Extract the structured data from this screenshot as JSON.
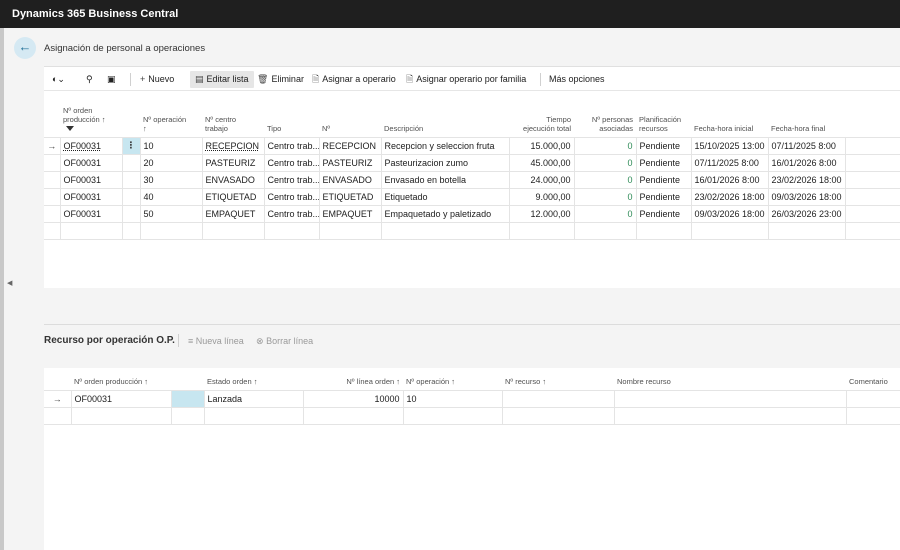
{
  "app": {
    "title": "Dynamics 365 Business Central"
  },
  "page": {
    "title": "Asignación de personal a operaciones"
  },
  "toolbar": {
    "nuevo": "Nuevo",
    "editar_lista": "Editar lista",
    "eliminar": "Eliminar",
    "asignar_operario": "Asignar a operario",
    "asignar_familia": "Asignar operario por familia",
    "mas_opciones": "Más opciones"
  },
  "main_grid": {
    "headers": {
      "orden_l1": "Nº orden",
      "orden_l2": "producción ↑",
      "operacion_l1": "Nº operación",
      "operacion_l2": "↑",
      "centro_l1": "Nº centro",
      "centro_l2": "trabajo",
      "tipo": "Tipo",
      "no": "Nº",
      "descripcion": "Descripción",
      "tiempo_l1": "Tiempo",
      "tiempo_l2": "ejecución total",
      "personas_l1": "Nº personas",
      "personas_l2": "asociadas",
      "planif_l1": "Planificación",
      "planif_l2": "recursos",
      "fecha_ini": "Fecha-hora inicial",
      "fecha_fin": "Fecha-hora final"
    },
    "rows": [
      {
        "orden": "OF00031",
        "operacion": "10",
        "centro": "RECEPCION",
        "tipo": "Centro trab...",
        "no": "RECEPCION",
        "descripcion": "Recepcion y seleccion fruta",
        "tiempo": "15.000,00",
        "personas": "0",
        "planif": "Pendiente",
        "fecha_ini": "15/10/2025 13:00",
        "fecha_fin": "07/11/2025 8:00"
      },
      {
        "orden": "OF00031",
        "operacion": "20",
        "centro": "PASTEURIZ",
        "tipo": "Centro trab...",
        "no": "PASTEURIZ",
        "descripcion": "Pasteurizacion zumo",
        "tiempo": "45.000,00",
        "personas": "0",
        "planif": "Pendiente",
        "fecha_ini": "07/11/2025 8:00",
        "fecha_fin": "16/01/2026 8:00"
      },
      {
        "orden": "OF00031",
        "operacion": "30",
        "centro": "ENVASADO",
        "tipo": "Centro trab...",
        "no": "ENVASADO",
        "descripcion": "Envasado en botella",
        "tiempo": "24.000,00",
        "personas": "0",
        "planif": "Pendiente",
        "fecha_ini": "16/01/2026 8:00",
        "fecha_fin": "23/02/2026 18:00"
      },
      {
        "orden": "OF00031",
        "operacion": "40",
        "centro": "ETIQUETAD",
        "tipo": "Centro trab...",
        "no": "ETIQUETAD",
        "descripcion": "Etiquetado",
        "tiempo": "9.000,00",
        "personas": "0",
        "planif": "Pendiente",
        "fecha_ini": "23/02/2026 18:00",
        "fecha_fin": "09/03/2026 18:00"
      },
      {
        "orden": "OF00031",
        "operacion": "50",
        "centro": "EMPAQUET",
        "tipo": "Centro trab...",
        "no": "EMPAQUET",
        "descripcion": "Empaquetado y paletizado",
        "tiempo": "12.000,00",
        "personas": "0",
        "planif": "Pendiente",
        "fecha_ini": "09/03/2026 18:00",
        "fecha_fin": "26/03/2026 23:00"
      }
    ]
  },
  "subpage": {
    "title": "Recurso por operación O.P.",
    "nueva_linea": "Nueva línea",
    "borrar_linea": "Borrar línea",
    "headers": {
      "orden": "Nº orden producción ↑",
      "estado": "Estado orden ↑",
      "linea": "Nº línea orden ↑",
      "operacion": "Nº operación ↑",
      "recurso": "Nº recurso ↑",
      "nombre": "Nombre recurso",
      "comentario": "Comentario"
    },
    "rows": [
      {
        "orden": "OF00031",
        "estado": "Lanzada",
        "linea": "10000",
        "operacion": "10",
        "recurso": "",
        "nombre": "",
        "comentario": ""
      }
    ]
  },
  "colors": {
    "topbar": "#1f1f1f",
    "selection": "#c7e6f0",
    "accent": "#1f6f97",
    "positive": "#2e8b57"
  }
}
